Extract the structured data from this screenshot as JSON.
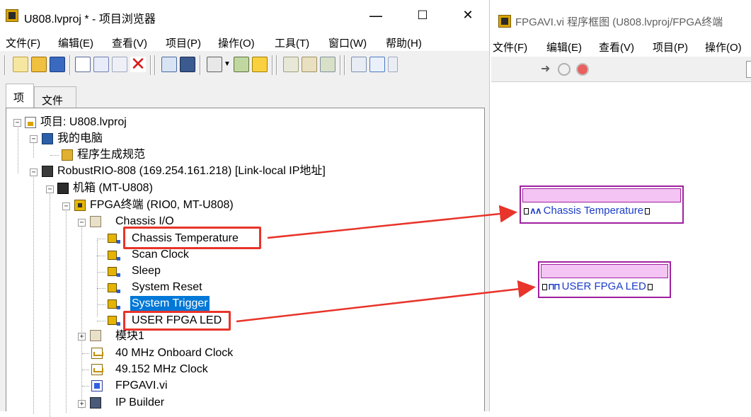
{
  "left_window": {
    "title": "U808.lvproj * - 项目浏览器",
    "window_buttons": [
      "—",
      "☐",
      "✕"
    ],
    "menu": [
      "文件(F)",
      "编辑(E)",
      "查看(V)",
      "项目(P)",
      "操作(O)",
      "工具(T)",
      "窗口(W)",
      "帮助(H)"
    ],
    "tabs": [
      "项",
      "文件"
    ],
    "tree": [
      {
        "label": "项目: U808.lvproj"
      },
      {
        "label": "我的电脑"
      },
      {
        "label": "程序生成规范"
      },
      {
        "label": "RobustRIO-808 (169.254.161.218) [Link-local IP地址]"
      },
      {
        "label": "机箱 (MT-U808)"
      },
      {
        "label": "FPGA终端 (RIO0, MT-U808)"
      },
      {
        "label": "Chassis I/O"
      },
      {
        "label": "Chassis Temperature"
      },
      {
        "label": "Scan Clock"
      },
      {
        "label": "Sleep"
      },
      {
        "label": "System Reset"
      },
      {
        "label": "System Trigger"
      },
      {
        "label": "USER FPGA LED"
      },
      {
        "label": "模块1"
      },
      {
        "label": "40 MHz Onboard Clock"
      },
      {
        "label": "49.152 MHz Clock"
      },
      {
        "label": "FPGAVI.vi"
      },
      {
        "label": "IP Builder"
      }
    ]
  },
  "right_window": {
    "title": "FPGAVI.vi 程序框图 (U808.lvproj/FPGA终端",
    "menu": [
      "文件(F)",
      "编辑(E)",
      "查看(V)",
      "项目(P)",
      "操作(O)"
    ],
    "nodes": [
      {
        "label": "Chassis Temperature",
        "wave": "ʌʌ"
      },
      {
        "label": "USER FPGA LED",
        "wave": "⊓⊓"
      }
    ]
  },
  "colors": {
    "highlight": "#e8342a",
    "selection": "#0078d7",
    "node_border": "#a020a0",
    "node_text": "#1a3cc8"
  }
}
